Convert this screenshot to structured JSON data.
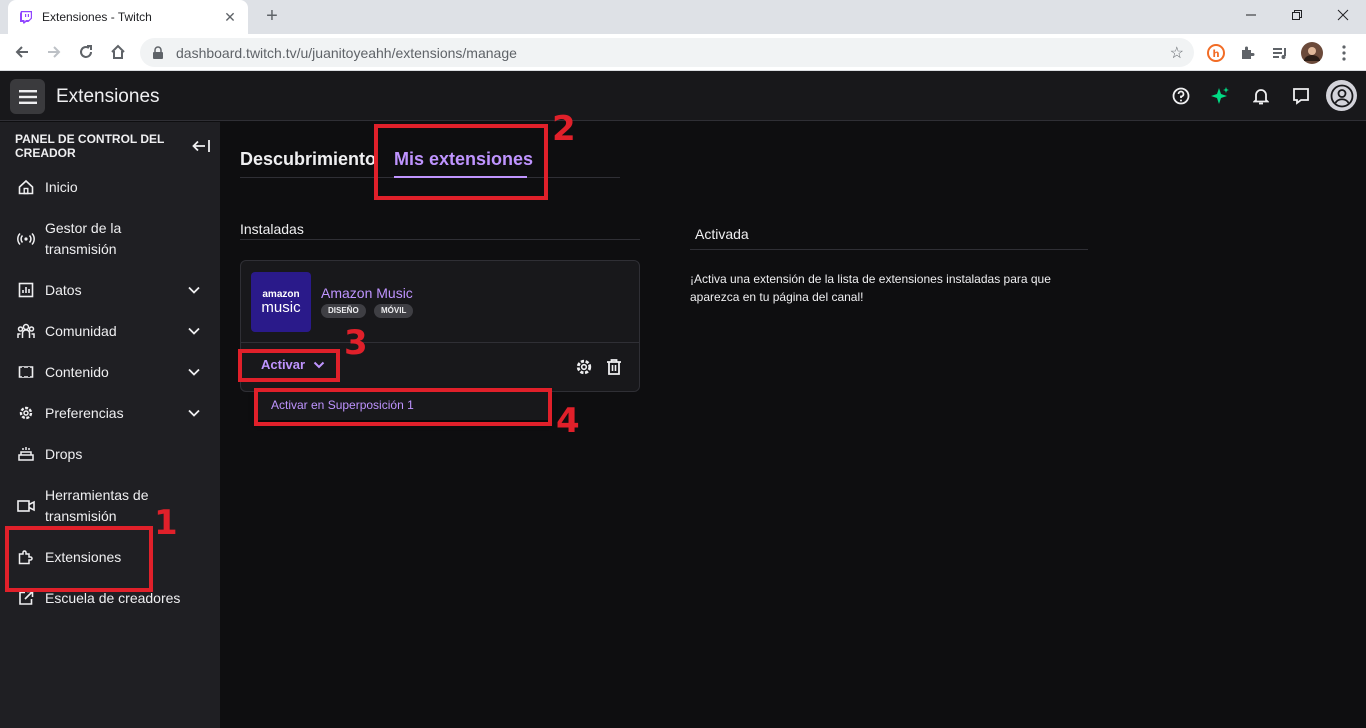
{
  "browser": {
    "tab_title": "Extensiones - Twitch",
    "tab_close": "✕",
    "new_tab": "+",
    "url": "dashboard.twitch.tv/u/juanitoyeahh/extensions/manage"
  },
  "header": {
    "title": "Extensiones"
  },
  "sidebar": {
    "heading": "PANEL DE CONTROL DEL CREADOR",
    "items": [
      {
        "label": "Inicio"
      },
      {
        "label": "Gestor de la transmisión"
      },
      {
        "label": "Datos"
      },
      {
        "label": "Comunidad"
      },
      {
        "label": "Contenido"
      },
      {
        "label": "Preferencias"
      },
      {
        "label": "Drops"
      },
      {
        "label": "Herramientas de transmisión"
      },
      {
        "label": "Extensiones"
      },
      {
        "label": "Escuela de creadores"
      }
    ]
  },
  "main": {
    "tabs": [
      {
        "label": "Descubrimiento"
      },
      {
        "label": "Mis extensiones"
      }
    ],
    "installed_heading": "Instaladas",
    "activated_heading": "Activada",
    "activated_message": "¡Activa una extensión de la lista de extensiones instaladas para que aparezca en tu página del canal!",
    "extension": {
      "logo_top": "amazon",
      "logo_bottom": "music",
      "name": "Amazon Music",
      "tags": [
        "DISEÑO",
        "MÓVIL"
      ],
      "activate_label": "Activar"
    },
    "dropdown_option": "Activar en Superposición 1"
  },
  "annotations": {
    "numbers": [
      "1",
      "2",
      "3",
      "4"
    ],
    "color": "#e0202a"
  },
  "colors": {
    "accent": "#bf94ff",
    "background": "#0e0e10",
    "sidebar": "#1f1f23"
  }
}
